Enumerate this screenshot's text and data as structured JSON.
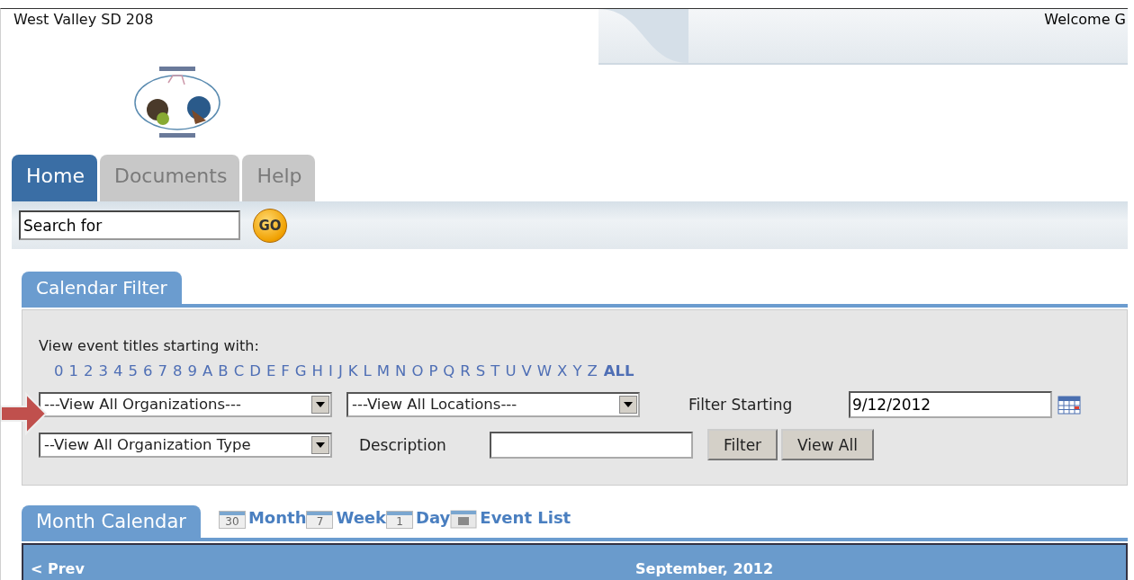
{
  "header": {
    "site_title": "West Valley SD 208",
    "welcome": "Welcome G"
  },
  "tabs": [
    {
      "label": "Home",
      "selected": true
    },
    {
      "label": "Documents",
      "selected": false
    },
    {
      "label": "Help",
      "selected": false
    }
  ],
  "search": {
    "value": "Search for",
    "button": "GO"
  },
  "filter": {
    "tab": "Calendar Filter",
    "prompt": "View event titles starting with:",
    "letters": [
      "0",
      "1",
      "2",
      "3",
      "4",
      "5",
      "6",
      "7",
      "8",
      "9",
      "A",
      "B",
      "C",
      "D",
      "E",
      "F",
      "G",
      "H",
      "I",
      "J",
      "K",
      "L",
      "M",
      "N",
      "O",
      "P",
      "Q",
      "R",
      "S",
      "T",
      "U",
      "V",
      "W",
      "X",
      "Y",
      "Z"
    ],
    "all_link": "ALL",
    "organizations": "---View All Organizations---",
    "locations": "---View All Locations---",
    "filter_starting_label": "Filter Starting",
    "date": "9/12/2012",
    "organization_types": "--View All Organization Type",
    "description_label": "Description",
    "buttons": [
      "Filter",
      "View All"
    ]
  },
  "calendar": {
    "tab": "Month Calendar",
    "views": [
      {
        "badge": "30",
        "label": "Month"
      },
      {
        "badge": "7",
        "label": "Week"
      },
      {
        "badge": "1",
        "label": "Day"
      },
      {
        "label": "Event List"
      }
    ],
    "prev": "< Prev",
    "title": "September, 2012"
  }
}
